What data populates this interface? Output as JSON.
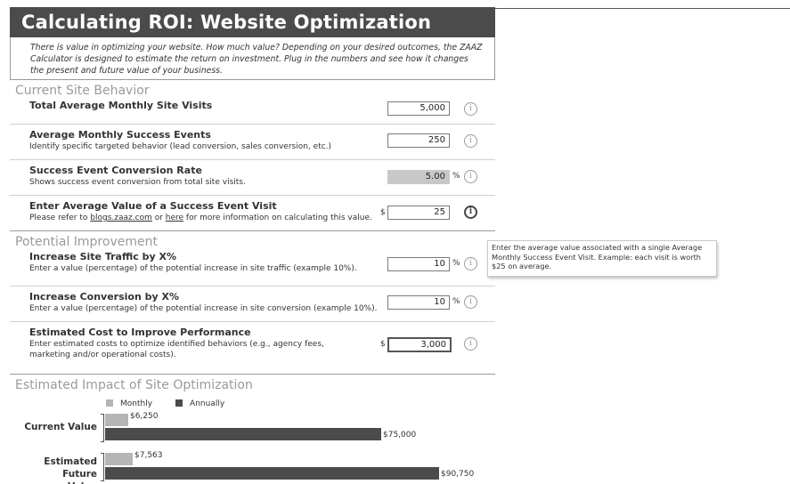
{
  "title": "Calculating ROI: Website Optimization",
  "intro": "There is value in optimizing your website. How much value? Depending on your desired outcomes, the ZAAZ Calculator is designed to estimate the return on investment. Plug in the numbers and see how it changes the present and future value of your business.",
  "sections": {
    "current": {
      "heading": "Current Site Behavior",
      "rows": [
        {
          "label": "Total Average Monthly Site Visits",
          "desc": "",
          "value": "5,000",
          "prefix": "",
          "suffix": "",
          "info_icon": "info-icon"
        },
        {
          "label": "Average Monthly Success Events",
          "desc": "Identify specific targeted behavior (lead conversion, sales conversion, etc.)",
          "value": "250",
          "prefix": "",
          "suffix": "",
          "info_icon": "info-icon"
        },
        {
          "label": "Success Event Conversion Rate",
          "desc": "Shows success event conversion from total site visits.",
          "value": "5.00",
          "prefix": "",
          "suffix": "%",
          "info_icon": "info-icon"
        },
        {
          "label": "Enter Average Value of a Success Event Visit",
          "desc_parts": {
            "before": "Please refer to ",
            "link1": "blogs.zaaz.com",
            "middle": " or ",
            "link2": "here",
            "after": " for more information on calculating this value."
          },
          "value": "25",
          "prefix": "$",
          "suffix": "",
          "info_icon": "info-icon"
        }
      ]
    },
    "potential": {
      "heading": "Potential Improvement",
      "rows": [
        {
          "label": "Increase Site Traffic by X%",
          "desc": "Enter a value (percentage) of the potential increase in site traffic (example 10%).",
          "value": "10",
          "prefix": "",
          "suffix": "%",
          "info_icon": "info-icon"
        },
        {
          "label": "Increase Conversion by X%",
          "desc": "Enter a value (percentage) of the potential increase in site conversion (example 10%).",
          "value": "10",
          "prefix": "",
          "suffix": "%",
          "info_icon": "info-icon"
        },
        {
          "label": "Estimated Cost to Improve Performance",
          "desc": "Enter estimated costs to optimize identified behaviors (e.g., agency fees, marketing and/or operational costs).",
          "value": "3,000",
          "prefix": "$",
          "suffix": "",
          "info_icon": "info-icon"
        }
      ]
    },
    "impact": {
      "heading": "Estimated Impact of Site Optimization"
    }
  },
  "tooltip": "Enter the average value associated with a single Average Monthly Success Event Visit. Example: each visit is worth $25 on average.",
  "chart_data": {
    "type": "bar",
    "orientation": "horizontal",
    "categories": [
      "Current Value",
      "Estimated Future Value"
    ],
    "series": [
      {
        "name": "Monthly",
        "values": [
          6250,
          7563
        ],
        "labels": [
          "$6,250",
          "$7,563"
        ],
        "color": "#b5b5b5"
      },
      {
        "name": "Annually",
        "values": [
          75000,
          90750
        ],
        "labels": [
          "$75,000",
          "$90,750"
        ],
        "color": "#4b4b4b"
      }
    ],
    "title": "",
    "xlabel": "",
    "ylabel": "",
    "legend": "top",
    "grid": false
  },
  "colors": {
    "title_bg": "#4b4b4b",
    "section_heading": "#9a9a9a",
    "monthly": "#b5b5b5",
    "annually": "#4b4b4b"
  }
}
